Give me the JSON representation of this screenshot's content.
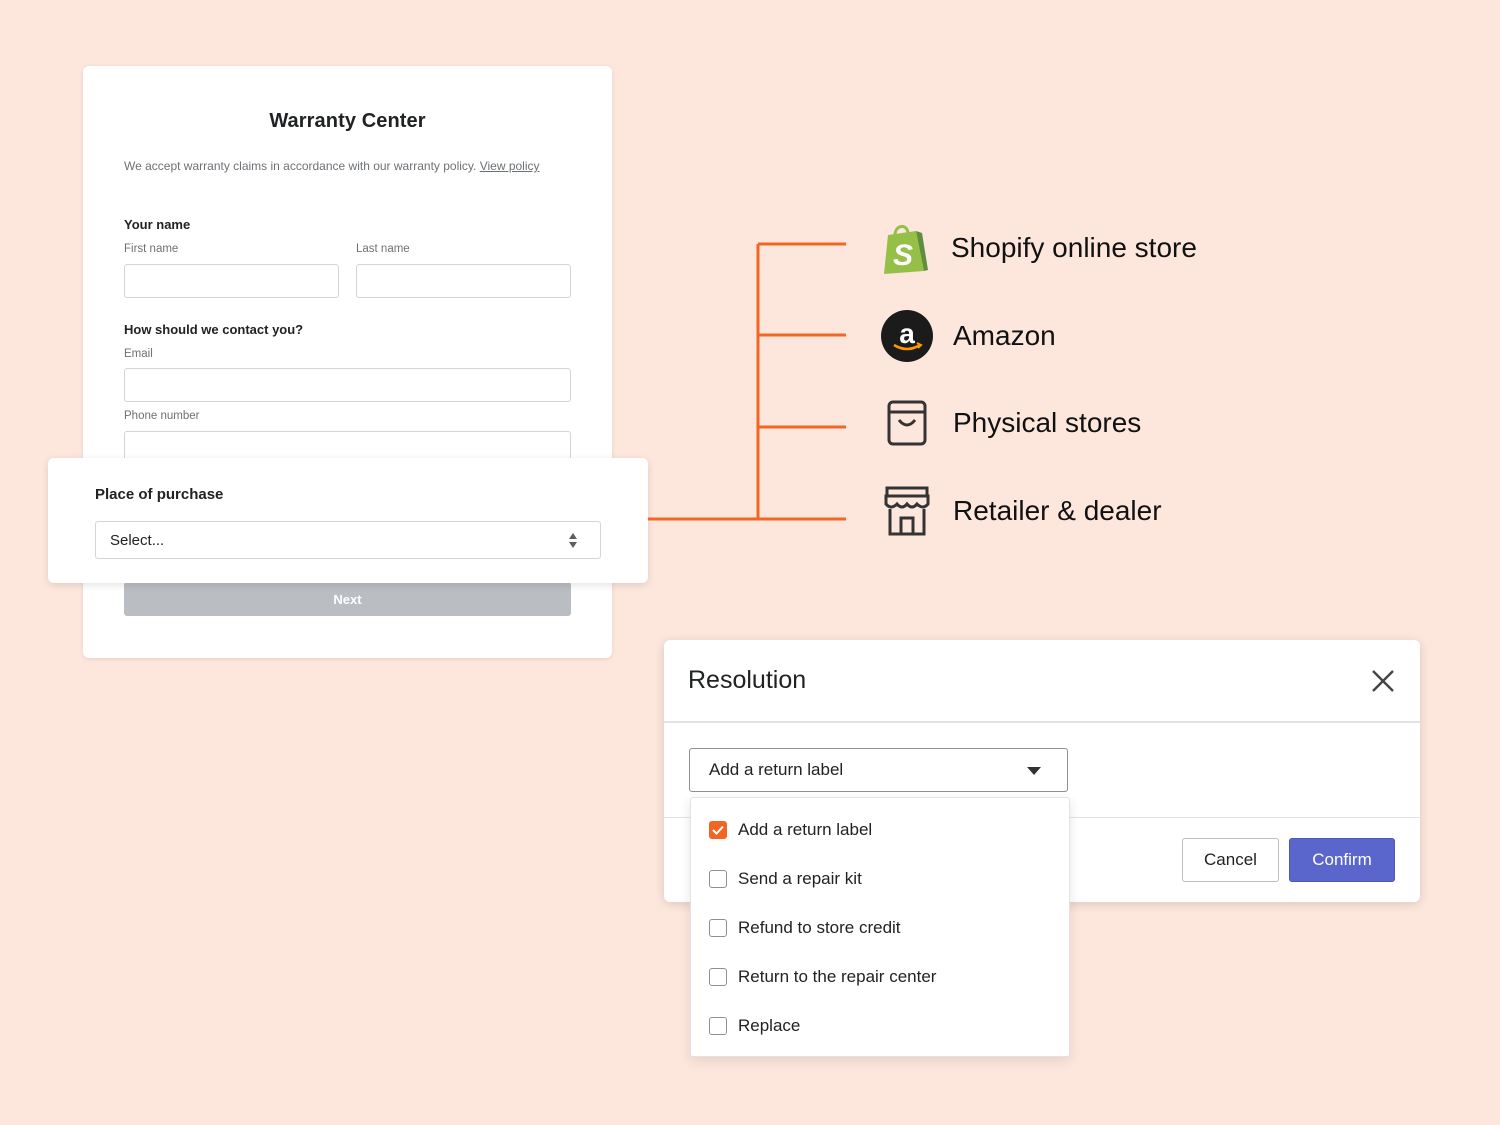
{
  "warranty_form": {
    "title": "Warranty Center",
    "intro": "We accept warranty claims in accordance with our warranty policy.",
    "intro_link": "View policy",
    "name_section": "Your name",
    "first_name_label": "First name",
    "last_name_label": "Last name",
    "contact_section": "How should we contact you?",
    "email_label": "Email",
    "phone_label": "Phone number",
    "next_label": "Next"
  },
  "place_of_purchase": {
    "label": "Place of purchase",
    "select_value": "Select..."
  },
  "stores": [
    {
      "label": "Shopify online store",
      "icon": "shopify-bag-icon"
    },
    {
      "label": "Amazon",
      "icon": "amazon-icon"
    },
    {
      "label": "Physical stores",
      "icon": "shopping-bag-icon"
    },
    {
      "label": "Retailer & dealer",
      "icon": "storefront-icon"
    }
  ],
  "resolution_modal": {
    "title": "Resolution",
    "select_value": "Add a return label",
    "cancel_label": "Cancel",
    "confirm_label": "Confirm",
    "options": [
      {
        "label": "Add a return label",
        "checked": true
      },
      {
        "label": "Send a repair kit",
        "checked": false
      },
      {
        "label": "Refund to store credit",
        "checked": false
      },
      {
        "label": "Return to the repair center",
        "checked": false
      },
      {
        "label": "Replace",
        "checked": false
      }
    ]
  },
  "colors": {
    "background": "#fde7dd",
    "accent_orange": "#f26522",
    "confirm_blue": "#5a66cc",
    "disabled_gray": "#babec3"
  }
}
